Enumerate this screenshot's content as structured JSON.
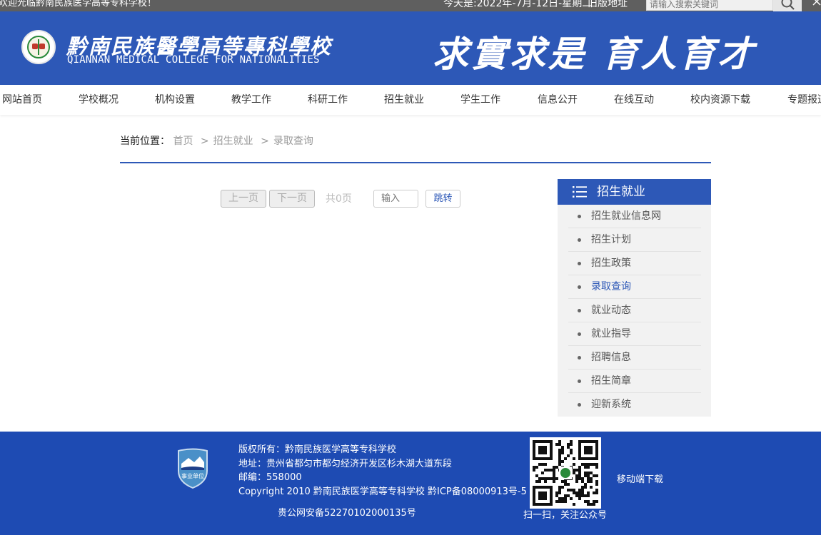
{
  "topbar": {
    "welcome": "欢迎光临黔南民族医学高等专科学校！",
    "date": "今天是:2022年-7月-12日-星期二",
    "old_site": "旧版地址",
    "search_placeholder": "请输入搜索关键词"
  },
  "header": {
    "school_name_cn": "黔南民族醫學高等專科學校",
    "school_name_en": "QIANNAN MEDICAL COLLEGE FOR NATIONALITIES",
    "motto": "求實求是 育人育才"
  },
  "nav": {
    "items": [
      "网站首页",
      "学校概况",
      "机构设置",
      "教学工作",
      "科研工作",
      "招生就业",
      "学生工作",
      "信息公开",
      "在线互动",
      "校内资源下载",
      "专题报道"
    ]
  },
  "breadcrumb": {
    "lead": "当前位置：",
    "items": [
      "首页",
      "招生就业",
      "录取查询"
    ],
    "separator": ">"
  },
  "pager": {
    "prev": "上一页",
    "next": "下一页",
    "total": "共0页",
    "input_placeholder": "输入",
    "jump": "跳转"
  },
  "sidebar": {
    "title": "招生就业",
    "items": [
      "招生就业信息网",
      "招生计划",
      "招生政策",
      "录取查询",
      "就业动态",
      "就业指导",
      "招聘信息",
      "招生简章",
      "迎新系统"
    ],
    "active_index": 3
  },
  "footer": {
    "badge_text": "事业单位",
    "copyright_owner": "版权所有：黔南民族医学高等专科学校",
    "address": "地址：贵州省都匀市都匀经济开发区杉木湖大道东段",
    "postcode": "邮编：558000",
    "copyright": "Copyright 2010 黔南民族医学高等专科学校 黔ICP备08000913号-5",
    "police_record": "贵公网安备52270102000135号",
    "qr_caption": "扫一扫，关注公众号",
    "mobile_download": "移动端下载"
  },
  "colors": {
    "brand_blue": "#2d58b7",
    "footer_blue": "#1e4bb3",
    "topbar_gray": "#5f5f5f"
  }
}
